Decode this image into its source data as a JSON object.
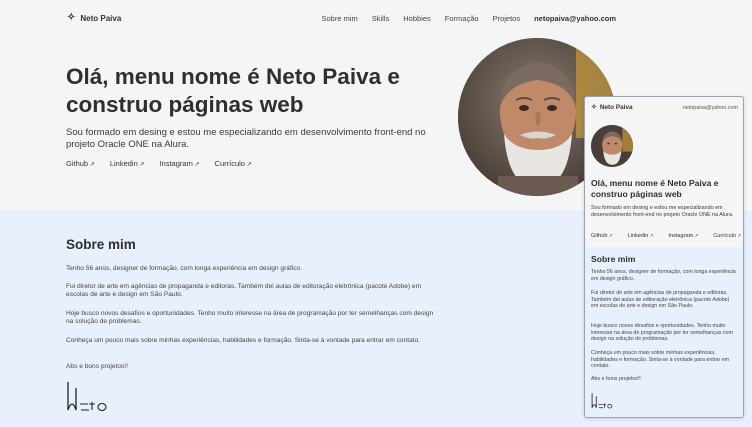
{
  "header": {
    "brand": "Neto Paiva",
    "nav": [
      "Sobre mim",
      "Skills",
      "Hobbies",
      "Formação",
      "Projetos"
    ],
    "email": "netopaiva@yahoo.com"
  },
  "hero": {
    "title": "Olá, menu nome é Neto Paiva e construo páginas web",
    "subtitle": "Sou formado em desing e estou me especializando em desenvolvimento front-end no projeto Oracle ONE na Alura.",
    "links": [
      "Github",
      "Linkedin",
      "Instagram",
      "Currículo"
    ]
  },
  "about": {
    "heading": "Sobre mim",
    "paragraphs": [
      "Tenho 56 anos, designer de formação, com longa experiência em design gráfico.",
      "Fui diretor de arte em agências de propaganda e editoras. Também dei aulas de editoração eletrônica (pacote Adobe) em escolas de arte e design em São Paulo.",
      "Hoje busco novos desafios e oportunidades. Tenho muito interesse na área de programação por ter semelhanças com design na solução de problemas.",
      "Conheça um pouco mais sobre minhas experiências, habilidades e formação. Sinta-se à vontade para entrar em contato.",
      "Abs e bons projetos!!"
    ]
  },
  "icons": {
    "brand": "sparkle-icon",
    "link": "arrow-up-right-icon",
    "signature": "signature-neto"
  },
  "colors": {
    "page_bg": "#f5f5f6",
    "about_bg": "#e8f0fd",
    "text": "#2f2f2f"
  }
}
